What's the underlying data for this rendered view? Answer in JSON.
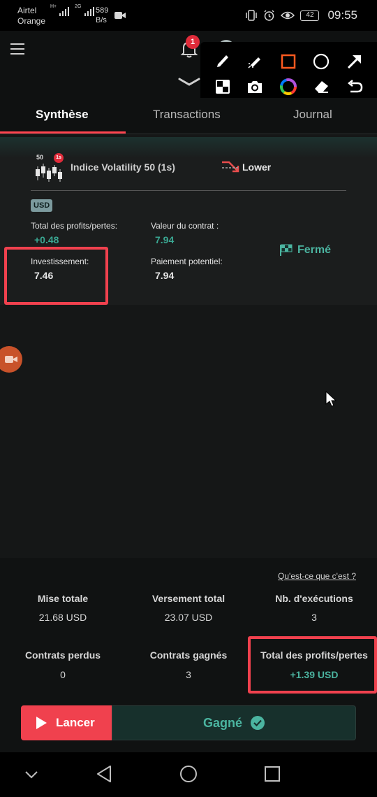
{
  "status_bar": {
    "carrier_line1": "Airtel",
    "carrier_line2": "Orange",
    "net_tag1": "H+",
    "net_tag2": "2G",
    "speed_value": "589",
    "speed_unit": "B/s",
    "battery": "42",
    "time": "09:55"
  },
  "header": {
    "notification_count": "1",
    "icons": [
      "menu-icon",
      "bell-icon",
      "avatar",
      "chevron-down-icon"
    ]
  },
  "annotation_toolbar": {
    "tools": [
      "pen-icon",
      "highlighter-icon",
      "rectangle-icon",
      "circle-icon",
      "arrow-icon",
      "mosaic-icon",
      "camera-icon",
      "color-wheel-icon",
      "eraser-icon",
      "undo-icon"
    ],
    "active_color": "#ff5a1f"
  },
  "tabs": [
    {
      "label": "Synthèse",
      "active": true
    },
    {
      "label": "Transactions",
      "active": false
    },
    {
      "label": "Journal",
      "active": false
    }
  ],
  "contract": {
    "asset_icon_label": "50",
    "asset_icon_badge": "1s",
    "asset_name": "Indice Volatility 50 (1s)",
    "trade_type": "Lower",
    "currency": "USD",
    "total_pl_label": "Total des profits/pertes:",
    "total_pl_value": "+0.48",
    "contract_value_label": "Valeur du contrat :",
    "contract_value": "7.94",
    "investment_label": "Investissement:",
    "investment_value": "7.46",
    "potential_payout_label": "Paiement potentiel:",
    "potential_payout_value": "7.94",
    "status": "Fermé"
  },
  "stats": {
    "help_link": "Qu'est-ce que c'est ?",
    "total_stake_label": "Mise totale",
    "total_stake_value": "21.68 USD",
    "total_payout_label": "Versement total",
    "total_payout_value": "23.07 USD",
    "runs_label": "Nb. d'exécutions",
    "runs_value": "3",
    "lost_label": "Contrats perdus",
    "lost_value": "0",
    "won_label": "Contrats gagnés",
    "won_value": "3",
    "total_pl_label": "Total des profits/pertes",
    "total_pl_value": "+1.39 USD"
  },
  "bottom": {
    "run_label": "Lancer",
    "result_label": "Gagné"
  },
  "colors": {
    "accent_red": "#ff444f",
    "profit_green": "#4bb4a0",
    "annotation_red": "#f0414e"
  }
}
